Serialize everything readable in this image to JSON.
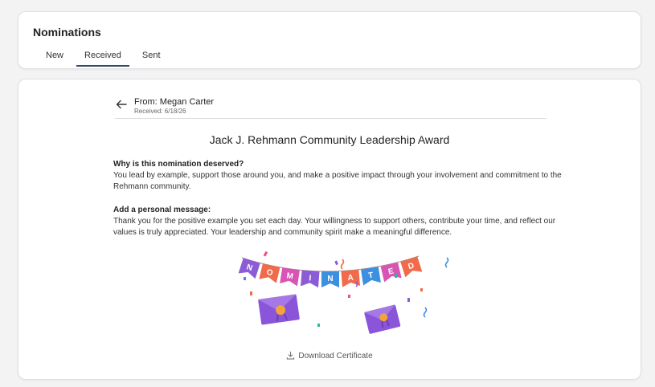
{
  "header": {
    "title": "Nominations",
    "tabs": [
      {
        "label": "New"
      },
      {
        "label": "Received"
      },
      {
        "label": "Sent"
      }
    ],
    "active_tab": "Received"
  },
  "nomination": {
    "from": "From: Megan Carter",
    "received": "Received: 6/18/26",
    "award": "Jack J. Rehmann Community Leadership Award",
    "why_label": "Why is this nomination deserved?",
    "why_text": "You lead by example, support those around you, and make a positive impact through your involvement and commitment to the Rehmann community.",
    "message_label": "Add a personal message:",
    "message_text": "Thank you for the positive example you set each day. Your willingness to support others, contribute your time, and reflect our values is truly appreciated. Your leadership and community spirit make a meaningful difference.",
    "banner_letters": [
      "N",
      "O",
      "M",
      "I",
      "N",
      "A",
      "T",
      "E",
      "D"
    ],
    "download_label": "Download Certificate"
  },
  "icons": {
    "back": "arrow-left-icon",
    "download": "download-icon"
  },
  "colors": {
    "tab_underline": "#2e4a6b",
    "flag_purple": "#8b5cd6",
    "flag_orange": "#f06a4b",
    "flag_blue": "#3d8fe0",
    "flag_pink": "#d955b5",
    "envelope": "#8a55d8"
  }
}
